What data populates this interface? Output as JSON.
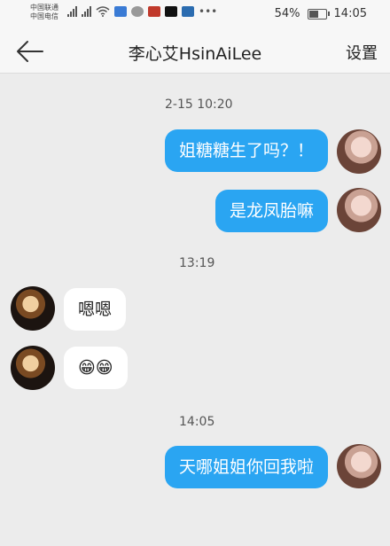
{
  "status_bar": {
    "carrier_1": "中国联通",
    "carrier_2": "中国电信",
    "battery": "54%",
    "time": "14:05"
  },
  "header": {
    "title": "李心艾HsinAiLee",
    "settings": "设置",
    "back_icon": "back-arrow-icon"
  },
  "messages": [
    {
      "timestamp": "2-15 10:20"
    },
    {
      "text": "姐糖糖生了吗？！",
      "direction": "outgoing"
    },
    {
      "text": "是龙凤胎嘛",
      "direction": "outgoing"
    },
    {
      "timestamp": "13:19"
    },
    {
      "text": "嗯嗯",
      "direction": "incoming"
    },
    {
      "text": "😁😁",
      "direction": "incoming"
    },
    {
      "timestamp": "14:05"
    },
    {
      "text": "天哪姐姐你回我啦",
      "direction": "outgoing"
    }
  ],
  "colors": {
    "outgoing_bubble": "#2aa5f2",
    "incoming_bubble": "#ffffff",
    "background": "#ececec"
  }
}
